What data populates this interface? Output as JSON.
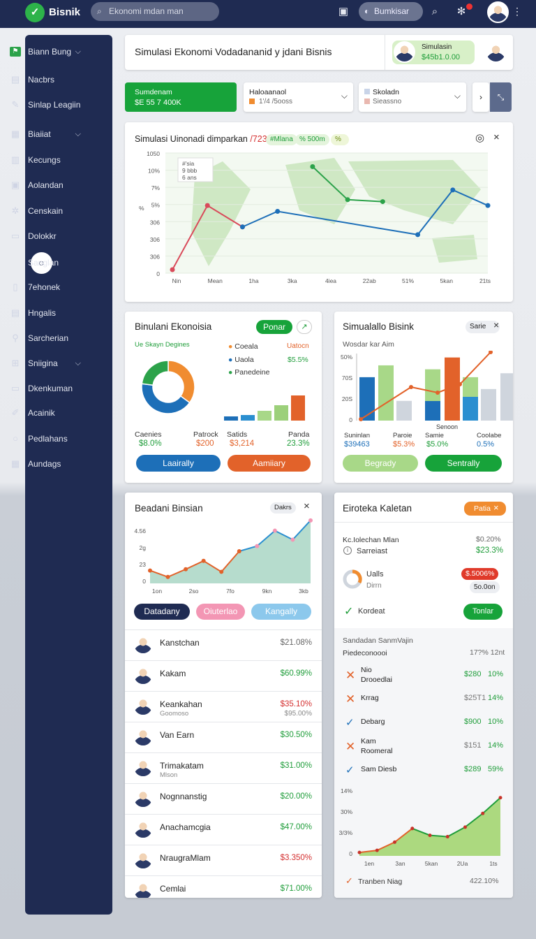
{
  "app": {
    "name": "Bisnik",
    "search_placeholder": "Ekonomi mdan man",
    "topbar_button": "Bumkisar"
  },
  "sidebar": {
    "items": [
      {
        "label": "Biann Bung",
        "icon": "flag-icon"
      },
      {
        "label": "Nacbrs",
        "icon": "list-icon"
      },
      {
        "label": "Sinlap Leagiin",
        "icon": "pen-icon"
      },
      {
        "label": "Biaiiat",
        "icon": "grid-icon"
      },
      {
        "label": "Kecungs",
        "icon": "table-icon"
      },
      {
        "label": "Aolandan",
        "icon": "calendar-icon"
      },
      {
        "label": "Censkain",
        "icon": "gear-icon"
      },
      {
        "label": "Dolokkr",
        "icon": "folder-icon"
      },
      {
        "label": "Sanglan",
        "icon": "circle-icon"
      },
      {
        "label": "7ehonek",
        "icon": "document-icon"
      },
      {
        "label": "Hngalis",
        "icon": "chat-icon"
      },
      {
        "label": "Sarcherian",
        "icon": "search-icon"
      },
      {
        "label": "Sniigina",
        "icon": "layers-icon"
      },
      {
        "label": "Dkenkuman",
        "icon": "monitor-icon"
      },
      {
        "label": "Acainik",
        "icon": "pencil-icon"
      },
      {
        "label": "Pedlahans",
        "icon": "circle-icon"
      },
      {
        "label": "Aundags",
        "icon": "table-icon"
      }
    ]
  },
  "header": {
    "title": "Simulasi Ekonomi Vodadananid y jdani Bisnis",
    "user_label": "Simulasin",
    "user_value": "$45b1.0.00"
  },
  "summary": {
    "green_label": "Sumdenam",
    "green_value": "$E 55 7 400K",
    "dd1_label": "Haloaanaol",
    "dd1_value": "1'/4 /5ooss",
    "dd2_label": "Skoladn",
    "dd2_value": "Sieassno"
  },
  "main_chart": {
    "title": "Simulasi Uinonadi dimparkan",
    "title_suffix": "/723.3%",
    "chip1": "#Mlana",
    "chip2": "% 500m",
    "chip3": "%  "
  },
  "chart_data": [
    {
      "type": "line",
      "title": "Simulasi Uinonadi dimparkan /723.3%",
      "categories": [
        "Nin",
        "Mean",
        "1ha",
        "3ka",
        "4iea",
        "22ab",
        "51%",
        "5kan",
        "21ts"
      ],
      "yticks": [
        "1050",
        "10%",
        "7%",
        "5%",
        "306",
        "306",
        "306",
        "0"
      ],
      "series": [
        {
          "color": "#d94a5a",
          "values": [
            0,
            3.3,
            2.2
          ]
        },
        {
          "color": "#1d6fb8",
          "values": [
            null,
            null,
            2.2,
            3.0,
            null,
            null,
            null,
            1.8,
            4.1,
            3.3
          ]
        },
        {
          "color": "#2ca24a",
          "values": [
            null,
            null,
            null,
            null,
            5.3,
            3.6,
            3.5,
            null,
            null,
            null
          ]
        }
      ],
      "legend": [
        "#'sia",
        "9 bbb",
        "6 ans"
      ]
    },
    {
      "type": "pie",
      "title": "Binulani Ekonoisia",
      "subtitle": "Ue Skayn Degines",
      "slices": [
        {
          "name": "Coeala",
          "value": 35,
          "color": "#f08c30"
        },
        {
          "name": "Uaola",
          "value": 42,
          "color": "#1d6fb8"
        },
        {
          "name": "Panedeine",
          "value": 23,
          "color": "#2ca24a"
        }
      ],
      "legend_values": [
        "Uatocn",
        "$5.5%"
      ]
    },
    {
      "type": "bar",
      "title": "Simualallo Bisink",
      "ylabel": "Wosdar kar Aim",
      "yticks": [
        "50%",
        "70S",
        "20S",
        "0"
      ],
      "values": [
        55,
        70,
        25,
        65,
        80,
        55,
        40,
        60
      ]
    },
    {
      "type": "area",
      "title": "Beadani Binsian",
      "x": [
        "1on",
        "2so",
        "7fo",
        "9kn",
        "3kb"
      ],
      "yticks": [
        "4.56",
        "2g",
        "23",
        "0"
      ],
      "values": [
        20,
        10,
        22,
        35,
        18,
        50,
        58,
        82,
        68,
        98
      ]
    },
    {
      "type": "area",
      "title": "",
      "x": [
        "1en",
        "3an",
        "5kan",
        "2Ua",
        "1ts"
      ],
      "yticks": [
        "14%",
        "30%",
        "3/3%",
        "0"
      ],
      "values": [
        5,
        8,
        20,
        40,
        30,
        28,
        42,
        62,
        85
      ]
    }
  ],
  "pie_card": {
    "button": "Ponar",
    "stats": [
      {
        "label": "Caenies",
        "value": "$8.0%"
      },
      {
        "label": "Patrock",
        "value": "$200"
      },
      {
        "label": "Satids",
        "value": "$3,214"
      },
      {
        "label": "Panda",
        "value": "23.3%"
      }
    ],
    "btn1": "Laairally",
    "btn2": "Aamiiary"
  },
  "bar_card": {
    "chip": "Sarie",
    "x_label": "Senoon",
    "stats": [
      {
        "label": "Suninlan",
        "value": "$39463"
      },
      {
        "label": "Paroie",
        "value": "$5.3%"
      },
      {
        "label": "Samie",
        "value": "$5.0%"
      },
      {
        "label": "Coolabe",
        "value": "0.5%"
      }
    ],
    "btn1": "Begrady",
    "btn2": "Sentrally"
  },
  "area_card": {
    "chip": "Dakrs",
    "btn1": "Datadany",
    "btn2": "Oiuterlao",
    "btn3": "Kangally"
  },
  "people": [
    {
      "name": "Kanstchan",
      "sub": "",
      "amount": "$21.08%",
      "amount_color": "gray"
    },
    {
      "name": "Kakam",
      "sub": "",
      "amount": "$60.99%",
      "amount_color": "green"
    },
    {
      "name": "Keankahan",
      "sub": "Goomoso",
      "amount": "$35.10%",
      "amount_color": "red",
      "amount2": "$95.00%"
    },
    {
      "name": "Van Earn",
      "sub": "",
      "amount": "$30.50%",
      "amount_color": "green"
    },
    {
      "name": "Trimakatam",
      "sub": "Mlson",
      "amount": "$31.00%",
      "amount_color": "green"
    },
    {
      "name": "Nognnanstig",
      "sub": "",
      "amount": "$20.00%",
      "amount_color": "green"
    },
    {
      "name": "Anachamcgia",
      "sub": "",
      "amount": "$47.00%",
      "amount_color": "green"
    },
    {
      "name": "NraugraMlam",
      "sub": "",
      "amount": "$3.350%",
      "amount_color": "red"
    },
    {
      "name": "Cemlai",
      "sub": "",
      "amount": "$71.00%",
      "amount_color": "green"
    }
  ],
  "right_card": {
    "title": "Eiroteka Kaletan",
    "chip": "Patia",
    "r1_label": "Kc.Iolechan Mlan",
    "r1_value": "$0.20%",
    "r2_label": "Sarreiast",
    "r2_value": "$23.3%",
    "r3_label": "Ualls",
    "r3_sub": "Dirrn",
    "r3_chip": "$.5006%",
    "r3_chip2": "5o.0on",
    "r4_label": "Kordeat",
    "r4_btn": "Tonlar",
    "sec_title": "Sandadan SanmVajin",
    "sec_sub": "Piedeconoooi",
    "sec_sub_val": "17?% 12nt",
    "items": [
      {
        "label": "Nio",
        "label2": "Drooedlai",
        "v1": "$280",
        "v2": "10%",
        "icon": "x"
      },
      {
        "label": "Krrag",
        "label2": "",
        "v1": "$25T1",
        "v2": "14%",
        "icon": "x"
      },
      {
        "label": "Debarg",
        "label2": "",
        "v1": "$900",
        "v2": "10%",
        "icon": "check"
      },
      {
        "label": "Kam",
        "label2": "Roomeral",
        "v1": "$151",
        "v2": "14%",
        "icon": "x"
      },
      {
        "label": "Sam Diesb",
        "label2": "",
        "v1": "$289",
        "v2": "59%",
        "icon": "check"
      }
    ],
    "footer_label": "Tranben Niag",
    "footer_value": "422.10%"
  }
}
